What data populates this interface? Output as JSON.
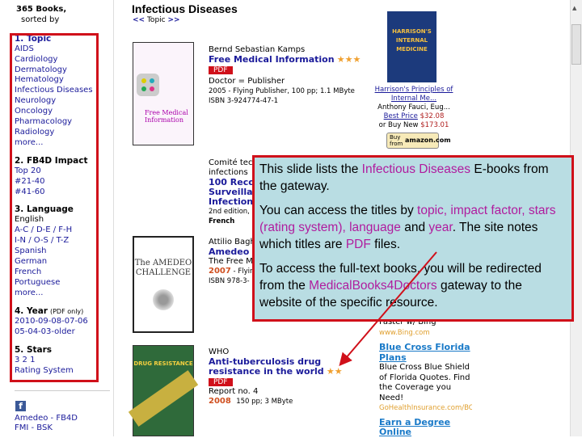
{
  "sidebar": {
    "count": "365 Books,",
    "sorted": "sorted by",
    "sections": [
      {
        "heading": "1. Topic",
        "items": [
          "AIDS",
          "Cardiology",
          "Dermatology",
          "Hematology",
          "Infectious Diseases",
          "Neurology",
          "Oncology",
          "Pharmacology",
          "Radiology",
          "more..."
        ]
      },
      {
        "heading": "2. FB4D Impact",
        "items": [
          "Top 20",
          "#21-40",
          "#41-60"
        ]
      },
      {
        "heading": "3. Language",
        "items": [
          "English",
          "A-C /  D-E /  F-H",
          "I-N /  O-S /  T-Z",
          "Spanish",
          "German",
          "French",
          "Portuguese",
          "more..."
        ]
      },
      {
        "heading": "4. Year",
        "note": "(PDF only)",
        "items": [
          "2010-09-08-07-06",
          "05-04-03-older"
        ]
      },
      {
        "heading": "5. Stars",
        "items": [
          "3   2   1",
          "Rating System"
        ]
      }
    ],
    "footer": [
      "Amedeo - FB4D",
      "FMI - BSK"
    ],
    "icons": {
      "social": "facebook-icon"
    }
  },
  "main": {
    "title": "Infectious Diseases",
    "nav_prev": "<<",
    "nav_label": "Topic",
    "nav_next": ">>",
    "books": [
      {
        "author": "Bernd Sebastian Kamps",
        "title": "Free Medical Information",
        "stars": "★★★",
        "pdf": "PDF",
        "subtitle": "Doctor = Publisher",
        "meta": "2005 - Flying Publisher, 100 pp; 1.1 MByte",
        "isbn": "ISBN 3-924774-47-1",
        "cover_text": "Free Medical Information"
      },
      {
        "author": "Comité tec",
        "author2": "infections",
        "title_lines": [
          "100 Recor",
          "Surveillan",
          "Infections"
        ],
        "meta": "2nd edition,",
        "lang": "French"
      },
      {
        "author": "Attilio Bagh",
        "title": "Amedeo C",
        "subtitle": "The Free M",
        "year": "2007",
        "meta": " - Flyin",
        "isbn": "ISBN 978-3-",
        "cover_text": "The AMEDEO CHALLENGE"
      },
      {
        "author": "WHO",
        "title_lines": [
          "Anti-tuberculosis drug",
          "resistance in the world"
        ],
        "stars": "★★",
        "pdf": "PDF",
        "subtitle": "Report no. 4",
        "year": "2008",
        "meta": "150 pp; 3 MByte",
        "cover_text": "DRUG RESISTANCE"
      }
    ]
  },
  "amazon": {
    "cover_text": "HARRISON'S INTERNAL MEDICINE",
    "title": "Harrison's Principles of",
    "title2": "Internal Me...",
    "author": "Anthony Fauci, Eug...",
    "best_label": "Best Price",
    "best_price": "$32.08",
    "new_label": "or Buy New",
    "new_price": "$173.01",
    "button_small": "Buy from",
    "button_brand": "amazon.com"
  },
  "ads": [
    {
      "text": "Faster w/ Bing",
      "url": "www.Bing.com"
    },
    {
      "title": "Blue Cross Florida Plans",
      "text": "Blue Cross Blue Shield of Florida Quotes. Find the Coverage you Need!",
      "url": "GoHealthInsurance.com/BC"
    },
    {
      "title": "Earn a Degree Online"
    }
  ],
  "callout": {
    "p1": [
      "This slide lists the ",
      "Infectious Diseases",
      " E-books from the gateway."
    ],
    "p2": [
      "You can access the titles by ",
      "topic, impact factor,  stars (rating system), language",
      " and ",
      "year",
      ".  The site notes which titles are ",
      "PDF",
      " files."
    ],
    "p3": [
      "To access the full-text books, you will be redirected from the ",
      "MedicalBooks4Doctors",
      " gateway to the website of the specific resource."
    ]
  },
  "colors": {
    "highlight": "#b01c9e",
    "frame": "#d0101a",
    "callout_bg": "#b9dde3",
    "link": "#1a1a9a"
  }
}
